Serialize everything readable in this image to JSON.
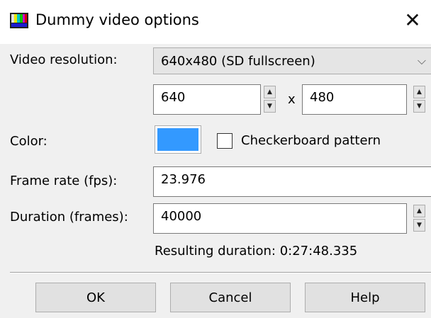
{
  "window": {
    "title": "Dummy video options",
    "icon": "color-bars-icon",
    "close_glyph": "✕"
  },
  "video_resolution": {
    "label": "Video resolution:",
    "selected": "640x480 (SD fullscreen)",
    "width": "640",
    "x_separator": "x",
    "height": "480"
  },
  "color": {
    "label": "Color:",
    "swatch_hex": "#3399ff",
    "checkerboard_label": "Checkerboard pattern",
    "checkerboard_checked": false
  },
  "frame_rate": {
    "label": "Frame rate (fps):",
    "value": "23.976"
  },
  "duration": {
    "label": "Duration (frames):",
    "value": "40000",
    "resulting": "Resulting duration: 0:27:48.335"
  },
  "buttons": {
    "ok": "OK",
    "cancel": "Cancel",
    "help": "Help"
  }
}
